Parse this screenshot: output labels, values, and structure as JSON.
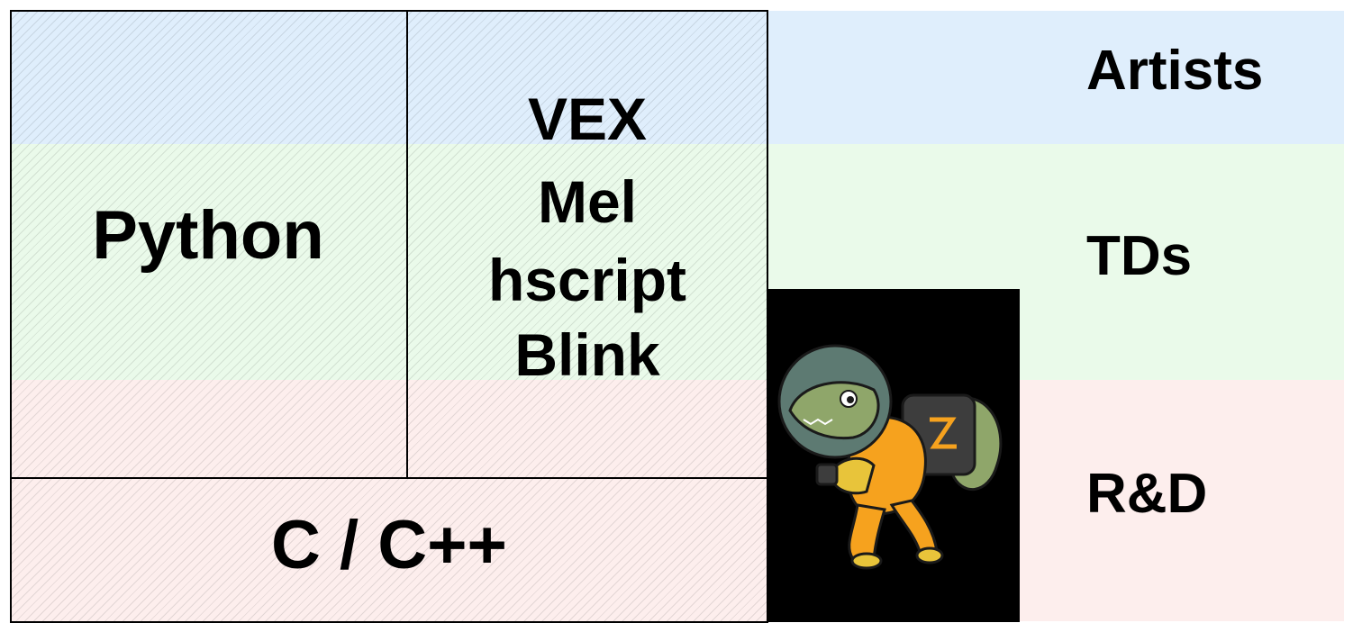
{
  "roles": [
    {
      "label": "Artists",
      "color": "#dfeefc"
    },
    {
      "label": "TDs",
      "color": "#eafaea"
    },
    {
      "label": "R&D",
      "color": "#fdeeed"
    }
  ],
  "languages": {
    "python": "Python",
    "scripts": [
      "VEX",
      "Mel",
      "hscript",
      "Blink"
    ],
    "c": "C / C++"
  },
  "mascot": {
    "icon": "lizard-astronaut-icon",
    "background": "#000000",
    "suit_color": "#f6a21e",
    "skin_color": "#8fa66a"
  }
}
